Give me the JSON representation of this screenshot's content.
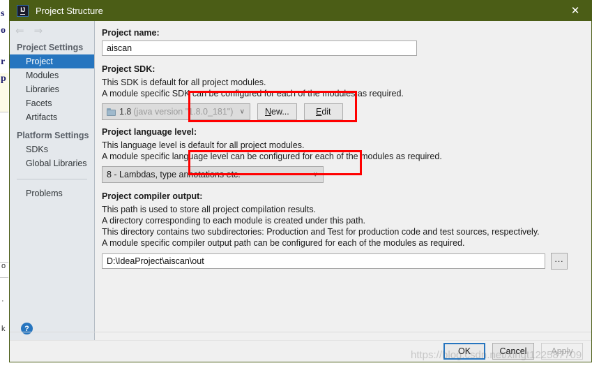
{
  "window": {
    "title": "Project Structure",
    "app_icon": "IJ",
    "close_icon": "✕",
    "titlebar_color": "#4b5d16"
  },
  "nav": {
    "back_icon": "⇐",
    "forward_icon": "⇒"
  },
  "sidebar": {
    "groups": [
      {
        "label": "Project Settings",
        "items": [
          {
            "label": "Project",
            "selected": true
          },
          {
            "label": "Modules",
            "selected": false
          },
          {
            "label": "Libraries",
            "selected": false
          },
          {
            "label": "Facets",
            "selected": false
          },
          {
            "label": "Artifacts",
            "selected": false
          }
        ]
      },
      {
        "label": "Platform Settings",
        "items": [
          {
            "label": "SDKs",
            "selected": false
          },
          {
            "label": "Global Libraries",
            "selected": false
          }
        ]
      }
    ],
    "problems_label": "Problems",
    "help_label": "?",
    "selected_color": "#2675bf"
  },
  "main": {
    "project_name": {
      "title": "Project name:",
      "value": "aiscan"
    },
    "project_sdk": {
      "title": "Project SDK:",
      "desc_line1": "This SDK is default for all project modules.",
      "desc_line2": "A module specific SDK can be configured for each of the modules as required.",
      "sdk_version": "1.8",
      "sdk_detail": "(java version \"1.8.0_181\")",
      "dropdown_icon": "∨",
      "new_button": {
        "pre": "",
        "mnemonic": "N",
        "post": "ew..."
      },
      "edit_button": {
        "pre": "",
        "mnemonic": "E",
        "post": "dit"
      }
    },
    "language_level": {
      "title": "Project language level:",
      "desc_line1": "This language level is default for all project modules.",
      "desc_line2": "A module specific language level can be configured for each of the modules as required.",
      "value": "8 - Lambdas, type annotations etc.",
      "dropdown_icon": "∨"
    },
    "compiler_output": {
      "title": "Project compiler output:",
      "desc_line1": "This path is used to store all project compilation results.",
      "desc_line2": "A directory corresponding to each module is created under this path.",
      "desc_line3": "This directory contains two subdirectories: Production and Test for production code and test sources, respectively.",
      "desc_line4": "A module specific compiler output path can be configured for each of the modules as required.",
      "value": "D:\\IdeaProject\\aiscan\\out",
      "browse_label": "..."
    }
  },
  "annotations": {
    "highlight_color": "#ff0000",
    "boxes": [
      "project-sdk-combo",
      "language-level-combo"
    ]
  },
  "footer": {
    "ok_label": "OK",
    "cancel_label": "Cancel",
    "apply_label": "Apply",
    "apply_enabled": false
  },
  "watermark": {
    "text": "https://blog.csdn.net/xingt122587709"
  },
  "backdrop": {
    "fragments": [
      "s",
      "o",
      "r",
      "p"
    ],
    "k_mark": "k",
    "dot_mark": "·",
    "o_mark": "o"
  }
}
